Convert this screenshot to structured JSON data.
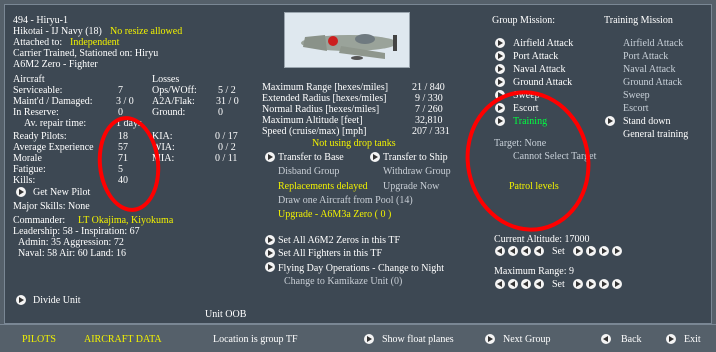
{
  "header": {
    "unit_title": "494 - Hiryu-1",
    "hikotai": "Hikotai - IJ Navy (18)",
    "no_resize": "No resize allowed",
    "attached_label": "Attached to:",
    "attached_value": "Independent",
    "carrier": "Carrier Trained, Stationed on: Hiryu",
    "aircraft_model": "A6M2 Zero - Fighter"
  },
  "aircraft_stats": {
    "aircraft_label": "Aircraft",
    "rows": [
      {
        "label": "Serviceable:",
        "value": "7"
      },
      {
        "label": "Maint'd / Damaged:",
        "value": "3 / 0"
      },
      {
        "label": "In Reserve:",
        "value": "0"
      },
      {
        "label": "Av. repair time:",
        "value": "1 days"
      }
    ]
  },
  "losses": {
    "label": "Losses",
    "rows": [
      {
        "label": "Ops/WOff:",
        "value": "5 / 2"
      },
      {
        "label": "A2A/Flak:",
        "value": "31 / 0"
      },
      {
        "label": "Ground:",
        "value": "0"
      }
    ]
  },
  "pilot_stats": {
    "rows": [
      {
        "label": "Ready Pilots:",
        "value": "18"
      },
      {
        "label": "Average Experience",
        "value": "57"
      },
      {
        "label": "Morale",
        "value": "71"
      },
      {
        "label": "Fatigue:",
        "value": "5"
      },
      {
        "label": "Kills:",
        "value": "40"
      }
    ],
    "kia": [
      {
        "label": "KIA:",
        "value": "0 / 17"
      },
      {
        "label": "WIA:",
        "value": "0 / 2"
      },
      {
        "label": "MIA:",
        "value": "0 / 11"
      }
    ]
  },
  "pilots": {
    "get_new_pilot": "Get New Pilot",
    "major_skills": "Major Skills:  None",
    "commander_label": "Commander:",
    "commander_name": "LT Okajima, Kiyokuma",
    "leadership": "Leadership: 58 - Inspiration: 67",
    "admin": "Admin: 35  Aggression: 72",
    "naval": "Naval: 58  Air: 60  Land: 16",
    "divide_unit": "Divide Unit",
    "unit_oob": "Unit OOB"
  },
  "ranges": {
    "rows": [
      {
        "label": "Maximum Range [hexes/miles]",
        "value": "21 / 840"
      },
      {
        "label": "Extended Radius [hexes/miles]",
        "value": "9 / 330"
      },
      {
        "label": "Normal Radius [hexes/miles]",
        "value": "7 / 260"
      },
      {
        "label": "Maximum Altitude [feet]",
        "value": "32,810"
      },
      {
        "label": "Speed (cruise/max) [mph]",
        "value": "207 / 331"
      }
    ],
    "drop_tanks": "Not using drop tanks"
  },
  "actions": {
    "transfer_base": "Transfer to Base",
    "transfer_ship": "Transfer to Ship",
    "disband": "Disband Group",
    "withdraw": "Withdraw Group",
    "replacements": "Replacements delayed",
    "upgrade_now": "Upgrade Now",
    "draw_aircraft": "Draw one Aircraft from Pool (14)",
    "upgrade_model": "Upgrade - A6M3a Zero  ( 0 )",
    "set_all_zeros": "Set All A6M2 Zeros in this TF",
    "set_all_fighters": "Set All Fighters in this TF",
    "flying_day": "Flying Day Operations - Change to Night",
    "kamikaze": "Change to Kamikaze Unit (0)"
  },
  "mission": {
    "group_mission_label": "Group Mission:",
    "training_mission_label": "Training Mission",
    "group_missions": [
      "Airfield Attack",
      "Port Attack",
      "Naval Attack",
      "Ground Attack",
      "Sweep",
      "Escort",
      "Training"
    ],
    "training_missions": [
      "Airfield Attack",
      "Port Attack",
      "Naval Attack",
      "Ground Attack",
      "Sweep",
      "Escort",
      "Stand down",
      "General training"
    ],
    "target": "Target: None",
    "cannot_select": "Cannot Select Target",
    "patrol_levels": "Patrol levels",
    "current_altitude": "Current Altitude: 17000",
    "maximum_range": "Maximum Range: 9",
    "set_label": "Set"
  },
  "bottom_bar": {
    "pilots": "PILOTS",
    "aircraft_data": "AIRCRAFT DATA",
    "location": "Location is group TF",
    "show_float_planes": "Show float planes",
    "next_group": "Next Group",
    "back": "Back",
    "exit": "Exit"
  },
  "colors": {
    "highlight_yellow": "#f2f200",
    "training_green": "#00ff40",
    "annotation_red": "#ff0000",
    "panel_bg": "#3d4853"
  }
}
